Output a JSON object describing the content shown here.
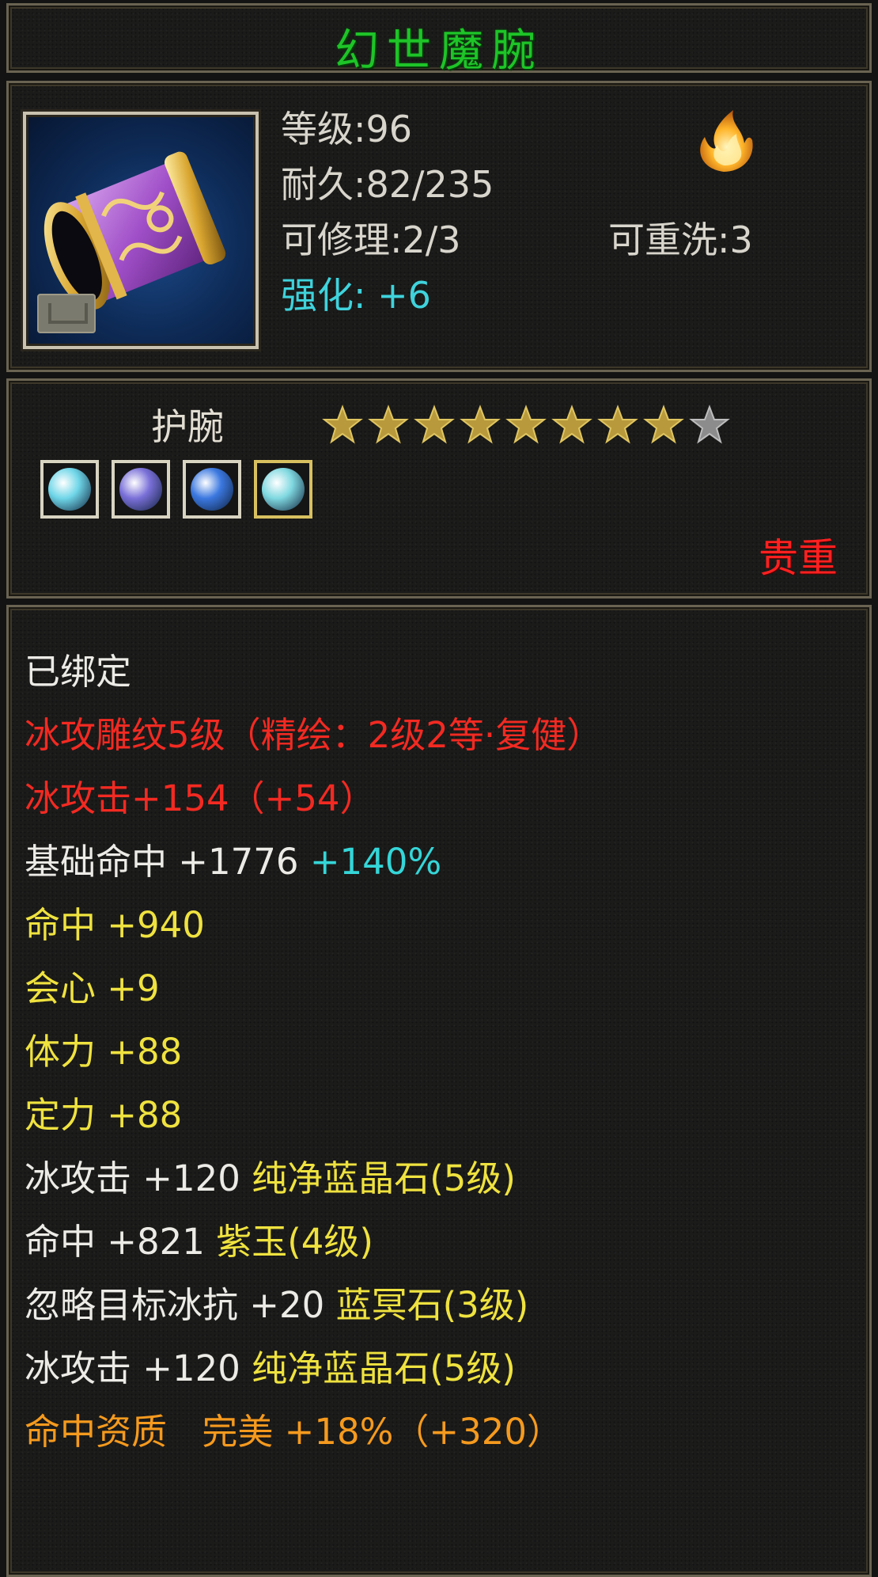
{
  "title": "幻世魔腕",
  "info": {
    "level": "等级:96",
    "durability": "耐久:82/235",
    "repair": "可修理:2/3",
    "rewash": "可重洗:3",
    "enhance": "强化: +6"
  },
  "equip_type": "护腕",
  "stars": {
    "filled": 8,
    "total": 9
  },
  "gems": [
    {
      "name": "gem-slot-1",
      "color": "#6fd6e8"
    },
    {
      "name": "gem-slot-2",
      "color": "#7a70d8"
    },
    {
      "name": "gem-slot-3",
      "color": "#3b78e0"
    },
    {
      "name": "gem-slot-4",
      "color": "#7fd8e0"
    }
  ],
  "rarity": "贵重",
  "attributes": {
    "bound": "已绑定",
    "engrave": "冰攻雕纹5级（精绘：2级2等·复健）",
    "ice_attack_main": "冰攻击+154（+54）",
    "base_hit_label": "基础命中 +1776",
    "base_hit_bonus": "+140%",
    "hit": "命中 +940",
    "crit": "会心 +9",
    "stamina": "体力 +88",
    "focus": "定力 +88",
    "gem1_stat": "冰攻击 +120",
    "gem1_name": "纯净蓝晶石(5级)",
    "gem2_stat": "命中 +821",
    "gem2_name": "紫玉(4级)",
    "gem3_stat": "忽略目标冰抗 +20",
    "gem3_name": "蓝冥石(3级)",
    "gem4_stat": "冰攻击 +120",
    "gem4_name": "纯净蓝晶石(5级)",
    "quality_label": "命中资质",
    "quality_grade": "完美",
    "quality_value": "+18%（+320）"
  },
  "colors": {
    "title_green": "#1ec428",
    "stat_red": "#f22a22",
    "stat_yellow": "#efe23f",
    "stat_cyan": "#35d6d8",
    "quality_orange": "#f59a1e",
    "rarity_red": "#ff2020"
  }
}
